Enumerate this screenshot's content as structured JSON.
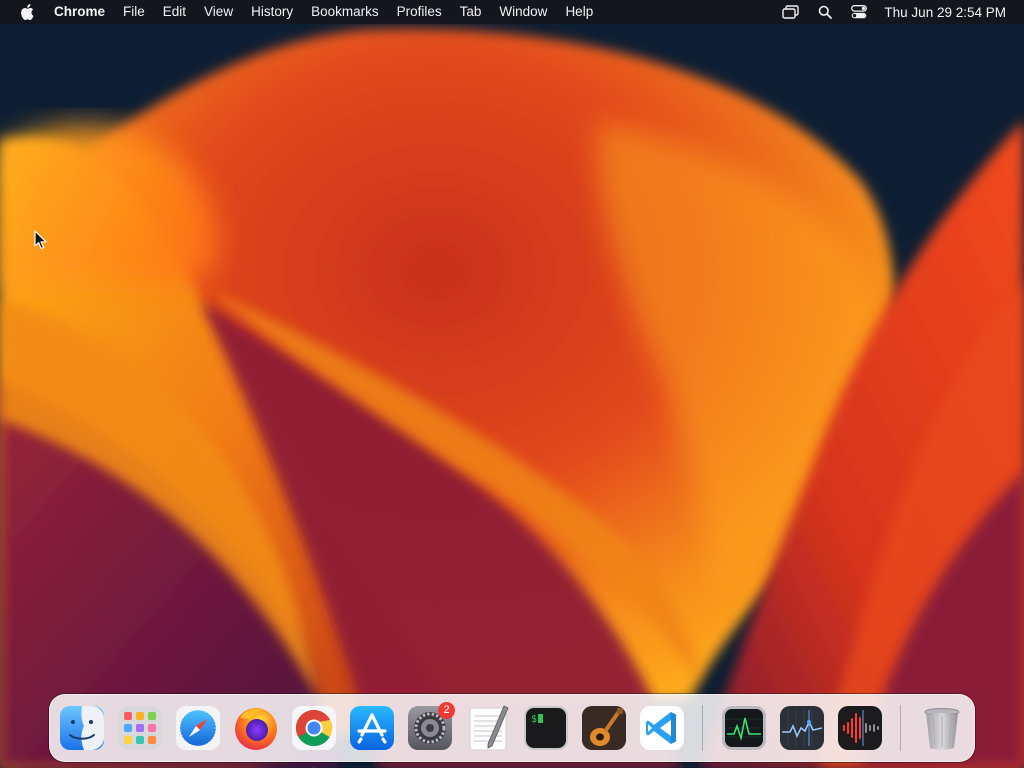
{
  "menubar": {
    "apple_icon": "apple-logo-icon",
    "app_name": "Chrome",
    "menus": [
      "File",
      "Edit",
      "View",
      "History",
      "Bookmarks",
      "Profiles",
      "Tab",
      "Window",
      "Help"
    ],
    "status_icons": [
      "screen-mirroring-icon",
      "spotlight-search-icon",
      "control-center-icon"
    ],
    "clock": "Thu Jun 29  2:54 PM"
  },
  "dock": {
    "apps": [
      {
        "name": "Finder",
        "icon": "finder-icon",
        "running": true
      },
      {
        "name": "Launchpad",
        "icon": "launchpad-icon",
        "running": false
      },
      {
        "name": "Safari",
        "icon": "safari-icon",
        "running": false
      },
      {
        "name": "Firefox",
        "icon": "firefox-icon",
        "running": false
      },
      {
        "name": "Google Chrome",
        "icon": "chrome-icon",
        "running": true
      },
      {
        "name": "App Store",
        "icon": "app-store-icon",
        "running": false
      },
      {
        "name": "System Settings",
        "icon": "system-settings-icon",
        "running": false,
        "badge": "2"
      },
      {
        "name": "TextEdit",
        "icon": "textedit-icon",
        "running": false
      },
      {
        "name": "Terminal",
        "icon": "terminal-icon",
        "running": false
      },
      {
        "name": "GarageBand",
        "icon": "garageband-icon",
        "running": false
      },
      {
        "name": "Visual Studio Code",
        "icon": "vscode-icon",
        "running": false
      }
    ],
    "others": [
      {
        "name": "Activity Monitor",
        "icon": "activity-monitor-icon"
      },
      {
        "name": "Stocks Window",
        "icon": "stocks-window-icon"
      },
      {
        "name": "Voice Memos",
        "icon": "voice-memos-icon"
      }
    ],
    "trash": {
      "name": "Trash",
      "icon": "trash-icon"
    }
  },
  "colors": {
    "menubar_bg": "#16161a",
    "wallpaper_dark": "#0c1f35",
    "wallpaper_orange": "#f08a1a",
    "wallpaper_red": "#c8321c",
    "badge": "#ee3b36"
  }
}
